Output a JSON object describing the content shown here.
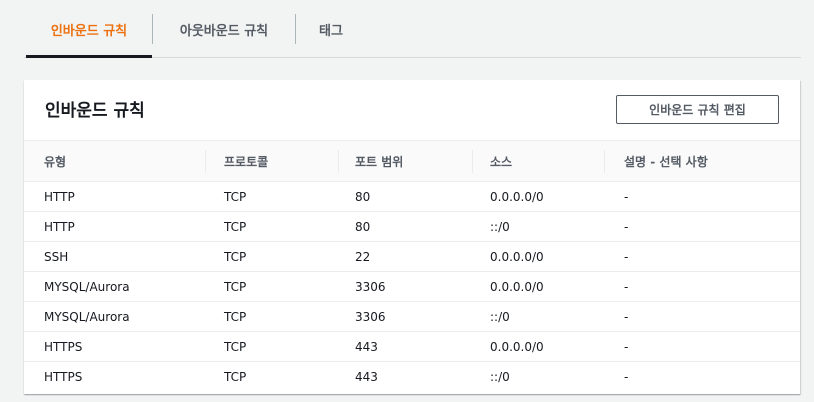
{
  "tabs": [
    {
      "label": "인바운드 규칙",
      "active": true
    },
    {
      "label": "아웃바운드 규칙",
      "active": false
    },
    {
      "label": "태그",
      "active": false
    }
  ],
  "panel": {
    "title": "인바운드 규칙",
    "edit_button": "인바운드 규칙 편집"
  },
  "table": {
    "columns": [
      "유형",
      "프로토콜",
      "포트 범위",
      "소스",
      "설명 - 선택 사항"
    ],
    "rows": [
      [
        "HTTP",
        "TCP",
        "80",
        "0.0.0.0/0",
        "-"
      ],
      [
        "HTTP",
        "TCP",
        "80",
        "::/0",
        "-"
      ],
      [
        "SSH",
        "TCP",
        "22",
        "0.0.0.0/0",
        "-"
      ],
      [
        "MYSQL/Aurora",
        "TCP",
        "3306",
        "0.0.0.0/0",
        "-"
      ],
      [
        "MYSQL/Aurora",
        "TCP",
        "3306",
        "::/0",
        "-"
      ],
      [
        "HTTPS",
        "TCP",
        "443",
        "0.0.0.0/0",
        "-"
      ],
      [
        "HTTPS",
        "TCP",
        "443",
        "::/0",
        "-"
      ]
    ]
  },
  "colors": {
    "accent": "#ec7211",
    "text": "#16191f",
    "muted": "#545b64",
    "background": "#f2f3f3"
  }
}
